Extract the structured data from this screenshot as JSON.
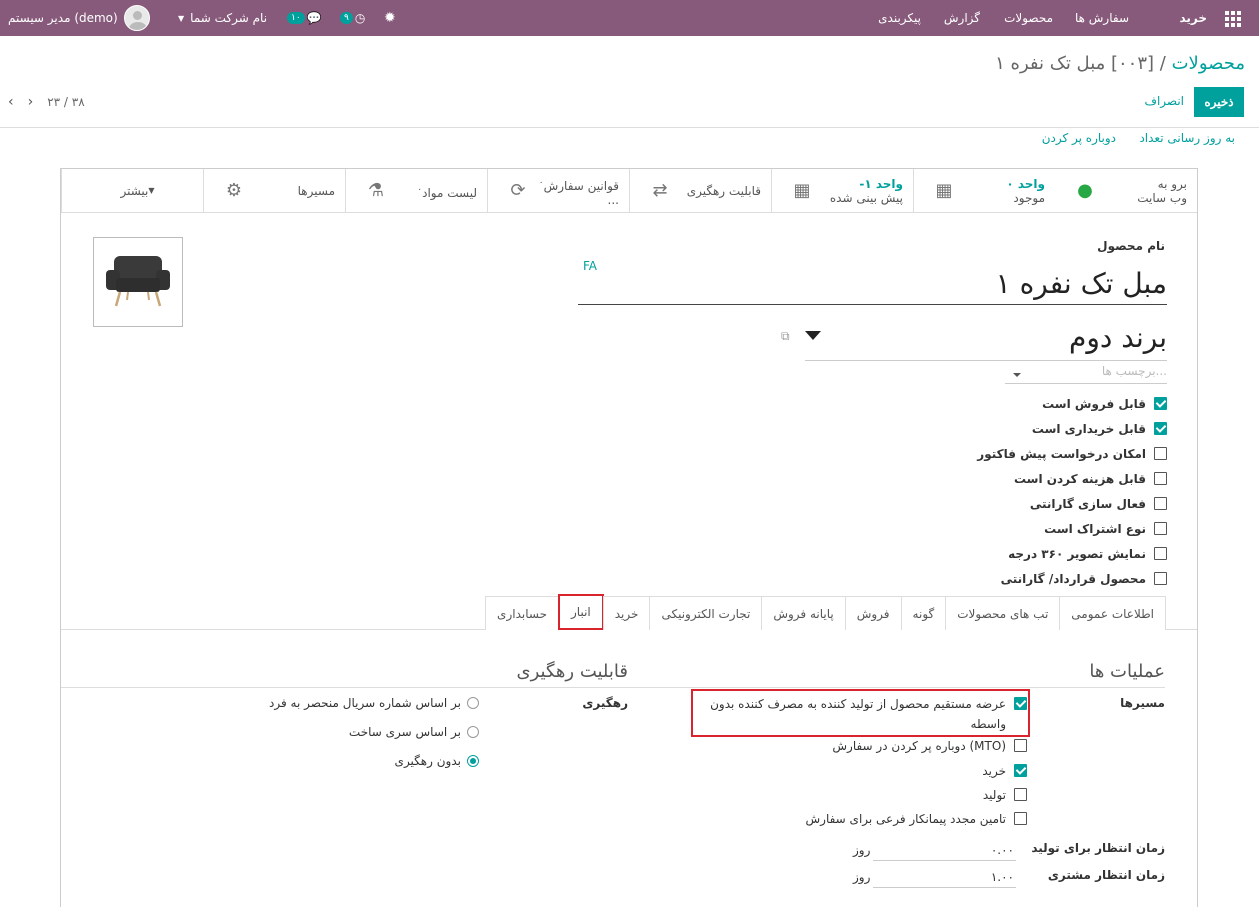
{
  "navbar": {
    "brand": "خرید",
    "menu": [
      "سفارش ها",
      "محصولات",
      "گزارش",
      "پیکربندی"
    ],
    "activity_count": "۹",
    "messages_count": "۱۰",
    "company": "نام شرکت شما",
    "user": "مدیر سیستم (demo)"
  },
  "control_panel": {
    "breadcrumb": "محصولات",
    "separator": "/",
    "record": "[۰۰۳] مبل تک نفره ۱",
    "save": "ذخیره",
    "discard": "انصراف",
    "pager": "۲۳ / ۳۸"
  },
  "header_buttons": {
    "update_qty": "به روز رسانی تعداد",
    "replenish": "دوباره پر کردن"
  },
  "smart_buttons": [
    {
      "label": "برو به",
      "sub": "وب سایت",
      "icon": "globe-icon"
    },
    {
      "value": "۰ واحد",
      "label": "موجود",
      "icon": "cubes-icon"
    },
    {
      "value": "-۱ واحد",
      "label": "پیش بینی شده",
      "icon": "cubes-icon"
    },
    {
      "label": "قابلیت رهگیری",
      "icon": "exchange-icon"
    },
    {
      "count": "۰",
      "label": "قوانین سفارش ...",
      "icon": "refresh-icon"
    },
    {
      "count": "۰",
      "label": "لیست مواد",
      "icon": "flask-icon"
    },
    {
      "label": "مسیرها",
      "icon": "cogs-icon"
    },
    {
      "label": "بیشتر",
      "icon": "caret-down-icon"
    }
  ],
  "form": {
    "name_label": "نام محصول",
    "lang": "FA",
    "name": "مبل تک نفره ۱",
    "brand": "برند دوم",
    "tags_placeholder": "برچسب ها...",
    "flags": [
      {
        "label": "قابل فروش است",
        "checked": true
      },
      {
        "label": "قابل خریداری است",
        "checked": true
      },
      {
        "label": "امکان درخواست پیش فاکتور",
        "checked": false
      },
      {
        "label": "قابل هزینه کردن است",
        "checked": false
      },
      {
        "label": "فعال سازی گارانتی",
        "checked": false
      },
      {
        "label": "نوع اشتراک است",
        "checked": false
      },
      {
        "label": "نمایش تصویر ۳۶۰ درجه",
        "checked": false
      },
      {
        "label": "محصول قرارداد/ گارانتی",
        "checked": false
      }
    ]
  },
  "tabs": [
    "اطلاعات عمومی",
    "تب های محصولات",
    "گونه",
    "فروش",
    "پایانه فروش",
    "تجارت الکترونیکی",
    "خرید",
    "انبار",
    "حسابداری"
  ],
  "active_tab": "انبار",
  "inventory": {
    "operations_title": "عملیات ها",
    "routes_label": "مسیرها",
    "routes": [
      {
        "label": "عرضه مستقیم محصول از تولید کننده به مصرف کننده بدون واسطه",
        "checked": true
      },
      {
        "label": "دوباره پر کردن در سفارش (MTO)",
        "checked": false
      },
      {
        "label": "خرید",
        "checked": true
      },
      {
        "label": "تولید",
        "checked": false
      },
      {
        "label": "تامین مجدد پیمانکار فرعی برای سفارش",
        "checked": false
      }
    ],
    "mfg_lead_label": "زمان انتظار برای تولید",
    "mfg_lead_value": "۰.۰۰",
    "customer_lead_label": "زمان انتظار مشتری",
    "customer_lead_value": "۱.۰۰",
    "days_unit": "روز",
    "traceability_title": "قابلیت رهگیری",
    "tracking_label": "رهگیری",
    "tracking_options": [
      {
        "label": "بر اساس شماره سریال منحصر به فرد",
        "selected": false
      },
      {
        "label": "بر اساس سری ساخت",
        "selected": false
      },
      {
        "label": "بدون رهگیری",
        "selected": true
      }
    ]
  },
  "colors": {
    "navbar": "#875a7b",
    "accent": "#00a09d",
    "highlight": "#d9232d"
  }
}
